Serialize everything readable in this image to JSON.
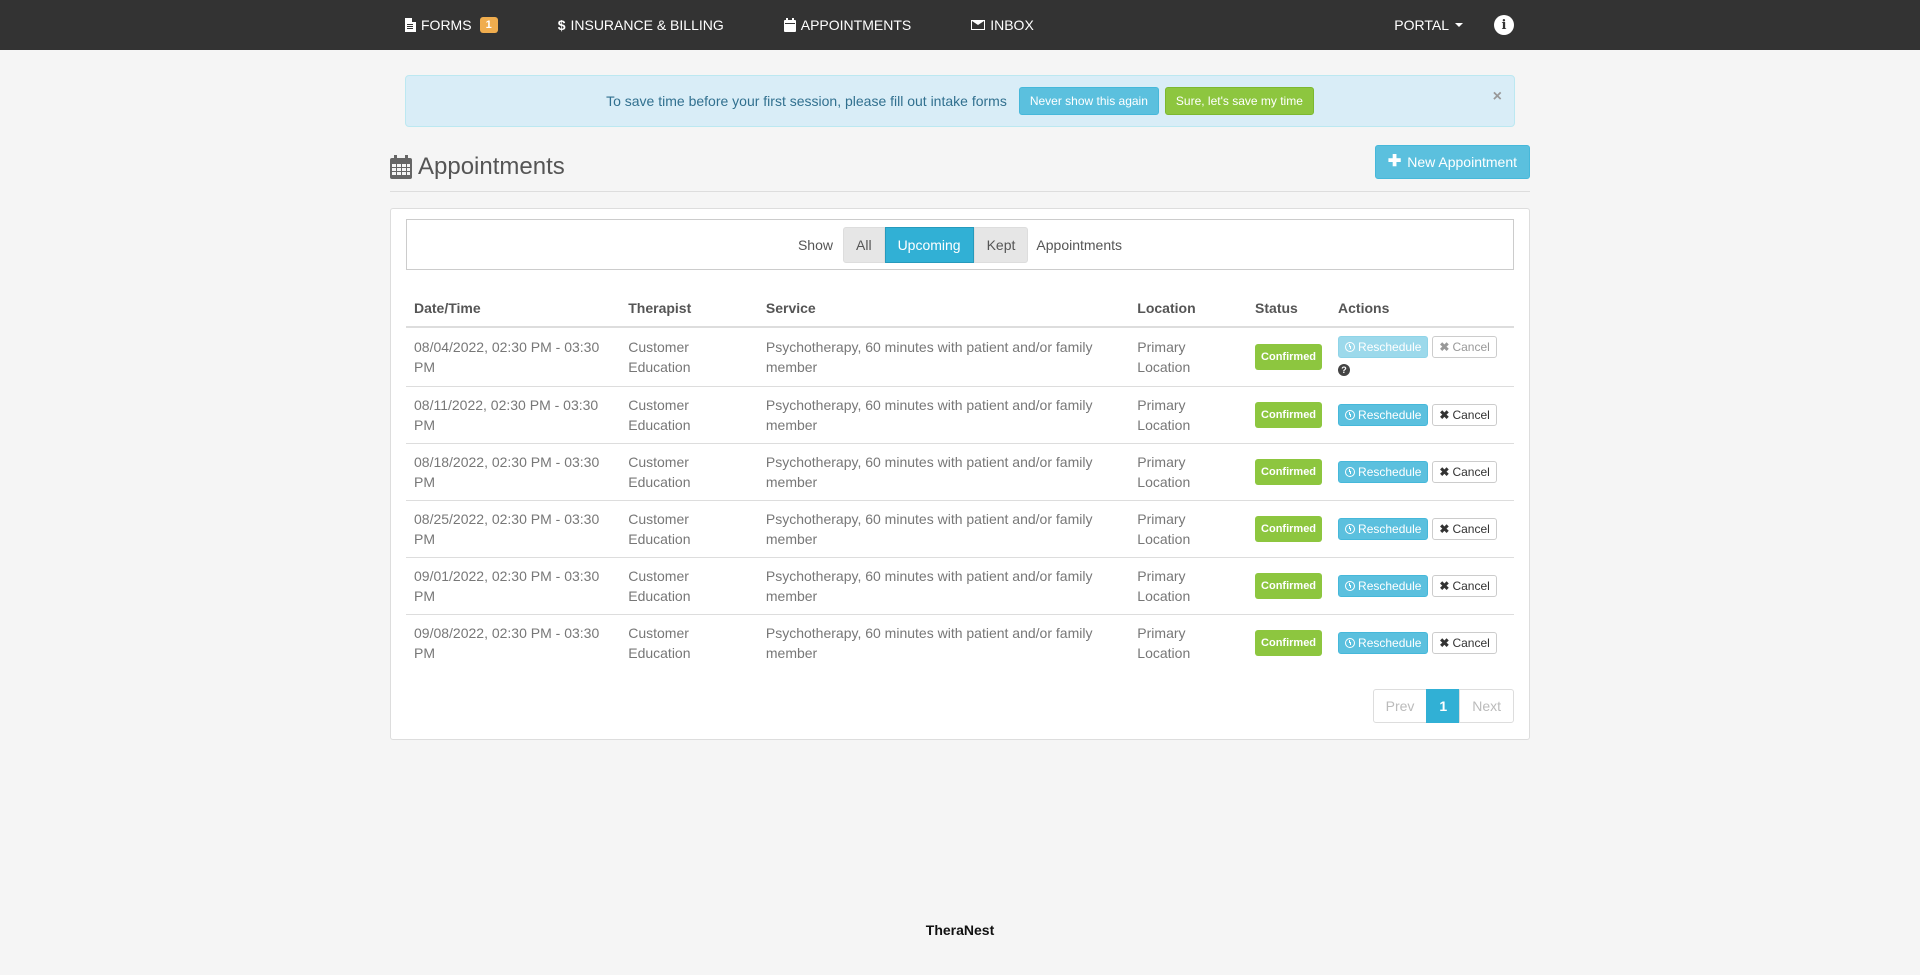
{
  "nav": {
    "forms": "FORMS",
    "forms_badge": "1",
    "billing": "INSURANCE & BILLING",
    "appointments": "APPOINTMENTS",
    "inbox": "INBOX",
    "portal": "PORTAL"
  },
  "alert": {
    "text": "To save time before your first session, please fill out intake forms",
    "never_btn": "Never show this again",
    "sure_btn": "Sure, let's save my time",
    "close": "×"
  },
  "header": {
    "title": "Appointments",
    "new_btn": "New Appointment"
  },
  "filter": {
    "show": "Show",
    "options": [
      "All",
      "Upcoming",
      "Kept"
    ],
    "selected": "Upcoming",
    "suffix": "Appointments"
  },
  "table": {
    "columns": [
      "Date/Time",
      "Therapist",
      "Service",
      "Location",
      "Status",
      "Actions"
    ],
    "rows": [
      {
        "datetime": "08/04/2022, 02:30 PM - 03:30 PM",
        "therapist": "Customer Education",
        "service": "Psychotherapy, 60 minutes with patient and/or family member",
        "location": "Primary Location",
        "status": "Confirmed",
        "reschedule": "Reschedule",
        "cancel": "Cancel"
      },
      {
        "datetime": "08/11/2022, 02:30 PM - 03:30 PM",
        "therapist": "Customer Education",
        "service": "Psychotherapy, 60 minutes with patient and/or family member",
        "location": "Primary Location",
        "status": "Confirmed",
        "reschedule": "Reschedule",
        "cancel": "Cancel"
      },
      {
        "datetime": "08/18/2022, 02:30 PM - 03:30 PM",
        "therapist": "Customer Education",
        "service": "Psychotherapy, 60 minutes with patient and/or family member",
        "location": "Primary Location",
        "status": "Confirmed",
        "reschedule": "Reschedule",
        "cancel": "Cancel"
      },
      {
        "datetime": "08/25/2022, 02:30 PM - 03:30 PM",
        "therapist": "Customer Education",
        "service": "Psychotherapy, 60 minutes with patient and/or family member",
        "location": "Primary Location",
        "status": "Confirmed",
        "reschedule": "Reschedule",
        "cancel": "Cancel"
      },
      {
        "datetime": "09/01/2022, 02:30 PM - 03:30 PM",
        "therapist": "Customer Education",
        "service": "Psychotherapy, 60 minutes with patient and/or family member",
        "location": "Primary Location",
        "status": "Confirmed",
        "reschedule": "Reschedule",
        "cancel": "Cancel"
      },
      {
        "datetime": "09/08/2022, 02:30 PM - 03:30 PM",
        "therapist": "Customer Education",
        "service": "Psychotherapy, 60 minutes with patient and/or family member",
        "location": "Primary Location",
        "status": "Confirmed",
        "reschedule": "Reschedule",
        "cancel": "Cancel"
      }
    ]
  },
  "pager": {
    "prev": "Prev",
    "current": "1",
    "next": "Next"
  },
  "footer": {
    "brand": "TheraNest"
  },
  "colors": {
    "navbar": "#333333",
    "info": "#5bc0de",
    "success": "#8dc63f",
    "badge": "#f0ad4e"
  }
}
